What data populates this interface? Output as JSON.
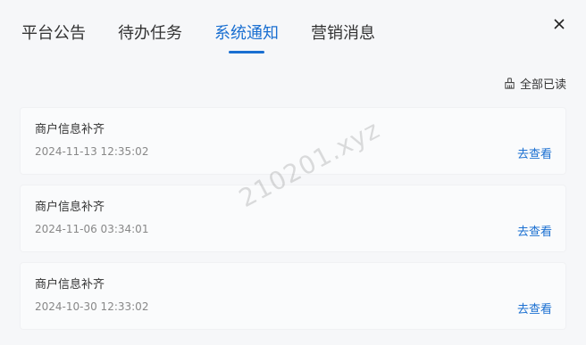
{
  "tabs": [
    {
      "label": "平台公告",
      "active": false
    },
    {
      "label": "待办任务",
      "active": false
    },
    {
      "label": "系统通知",
      "active": true
    },
    {
      "label": "营销消息",
      "active": false
    }
  ],
  "close_icon": "close-icon",
  "mark_all_read": {
    "label": "全部已读",
    "icon": "broom-icon"
  },
  "notifications": [
    {
      "title": "商户信息补齐",
      "time": "2024-11-13 12:35:02",
      "action": "去查看"
    },
    {
      "title": "商户信息补齐",
      "time": "2024-11-06 03:34:01",
      "action": "去查看"
    },
    {
      "title": "商户信息补齐",
      "time": "2024-10-30 12:33:02",
      "action": "去查看"
    }
  ],
  "watermark": "210201.xyz",
  "colors": {
    "accent": "#1a6fd1",
    "text": "#333333",
    "muted": "#888888",
    "background": "#f6f7f9"
  }
}
